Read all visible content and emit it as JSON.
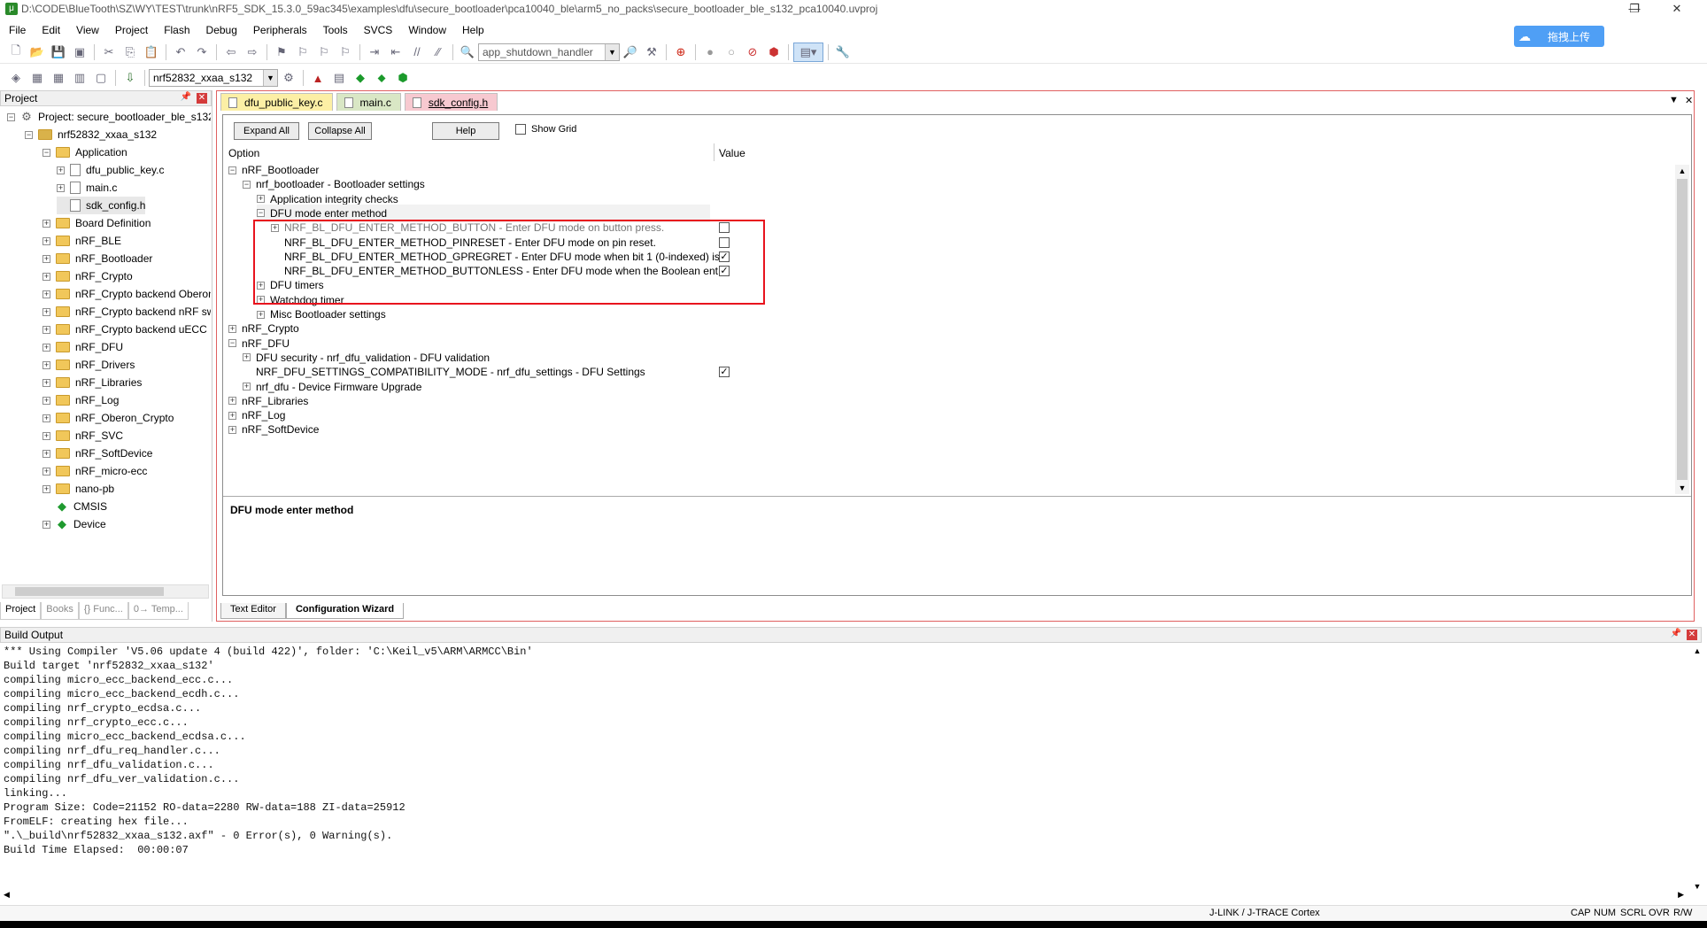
{
  "window": {
    "title": "D:\\CODE\\BlueTooth\\SZ\\WY\\TEST\\trunk\\nRF5_SDK_15.3.0_59ac345\\examples\\dfu\\secure_bootloader\\pca10040_ble\\arm5_no_packs\\secure_bootloader_ble_s132_pca10040.uvproj",
    "minimize": "—",
    "restore": "❐",
    "close": "✕"
  },
  "menu": [
    "File",
    "Edit",
    "View",
    "Project",
    "Flash",
    "Debug",
    "Peripherals",
    "Tools",
    "SVCS",
    "Window",
    "Help"
  ],
  "toolbar": {
    "function_combo": "app_shutdown_handler",
    "target_combo": "nrf52832_xxaa_s132"
  },
  "upload_button": "拖拽上传",
  "project_panel": {
    "title": "Project",
    "tree": [
      {
        "label": "Project: secure_bootloader_ble_s132_",
        "indent": 0,
        "expander": "−",
        "icon": "project"
      },
      {
        "label": "nrf52832_xxaa_s132",
        "indent": 1,
        "expander": "−",
        "icon": "target"
      },
      {
        "label": "Application",
        "indent": 2,
        "expander": "−",
        "icon": "folder"
      },
      {
        "label": "dfu_public_key.c",
        "indent": 3,
        "expander": "+",
        "icon": "file"
      },
      {
        "label": "main.c",
        "indent": 3,
        "expander": "+",
        "icon": "file"
      },
      {
        "label": "sdk_config.h",
        "indent": 3,
        "expander": "",
        "icon": "file"
      },
      {
        "label": "Board Definition",
        "indent": 2,
        "expander": "+",
        "icon": "folder"
      },
      {
        "label": "nRF_BLE",
        "indent": 2,
        "expander": "+",
        "icon": "folder"
      },
      {
        "label": "nRF_Bootloader",
        "indent": 2,
        "expander": "+",
        "icon": "folder"
      },
      {
        "label": "nRF_Crypto",
        "indent": 2,
        "expander": "+",
        "icon": "folder"
      },
      {
        "label": "nRF_Crypto backend Oberon",
        "indent": 2,
        "expander": "+",
        "icon": "folder"
      },
      {
        "label": "nRF_Crypto backend nRF sw",
        "indent": 2,
        "expander": "+",
        "icon": "folder"
      },
      {
        "label": "nRF_Crypto backend uECC",
        "indent": 2,
        "expander": "+",
        "icon": "folder"
      },
      {
        "label": "nRF_DFU",
        "indent": 2,
        "expander": "+",
        "icon": "folder"
      },
      {
        "label": "nRF_Drivers",
        "indent": 2,
        "expander": "+",
        "icon": "folder"
      },
      {
        "label": "nRF_Libraries",
        "indent": 2,
        "expander": "+",
        "icon": "folder"
      },
      {
        "label": "nRF_Log",
        "indent": 2,
        "expander": "+",
        "icon": "folder"
      },
      {
        "label": "nRF_Oberon_Crypto",
        "indent": 2,
        "expander": "+",
        "icon": "folder"
      },
      {
        "label": "nRF_SVC",
        "indent": 2,
        "expander": "+",
        "icon": "folder"
      },
      {
        "label": "nRF_SoftDevice",
        "indent": 2,
        "expander": "+",
        "icon": "folder"
      },
      {
        "label": "nRF_micro-ecc",
        "indent": 2,
        "expander": "+",
        "icon": "folder"
      },
      {
        "label": "nano-pb",
        "indent": 2,
        "expander": "+",
        "icon": "folder"
      },
      {
        "label": "CMSIS",
        "indent": 2,
        "expander": "",
        "icon": "gem"
      },
      {
        "label": "Device",
        "indent": 2,
        "expander": "+",
        "icon": "gem"
      }
    ],
    "bottom_tabs": [
      "Project",
      "Books",
      "{} Func...",
      "0→ Temp..."
    ]
  },
  "file_tabs": [
    {
      "label": "dfu_public_key.c",
      "style": "y"
    },
    {
      "label": "main.c",
      "style": "g"
    },
    {
      "label": "sdk_config.h",
      "style": "active"
    }
  ],
  "wizard": {
    "expand_all": "Expand All",
    "collapse_all": "Collapse All",
    "help": "Help",
    "show_grid": "Show Grid",
    "col_option": "Option",
    "col_value": "Value",
    "rows": [
      {
        "label": "nRF_Bootloader",
        "indent": 0,
        "expander": "−",
        "value": null,
        "dim": false
      },
      {
        "label": "nrf_bootloader - Bootloader settings",
        "indent": 1,
        "expander": "−",
        "value": null,
        "dim": false
      },
      {
        "label": "Application integrity checks",
        "indent": 2,
        "expander": "+",
        "value": null,
        "dim": false
      },
      {
        "label": "DFU mode enter method",
        "indent": 2,
        "expander": "−",
        "value": null,
        "dim": false,
        "highlight": true
      },
      {
        "label": "NRF_BL_DFU_ENTER_METHOD_BUTTON - Enter DFU mode on button press.",
        "indent": 3,
        "expander": "+",
        "value": false,
        "dim": true
      },
      {
        "label": "NRF_BL_DFU_ENTER_METHOD_PINRESET  - Enter DFU mode on pin reset.",
        "indent": 3,
        "expander": "",
        "value": false,
        "dim": false
      },
      {
        "label": "NRF_BL_DFU_ENTER_METHOD_GPREGRET  - Enter DFU mode when bit 1 (0-indexed) is...",
        "indent": 3,
        "expander": "",
        "value": true,
        "dim": false
      },
      {
        "label": "NRF_BL_DFU_ENTER_METHOD_BUTTONLESS  - Enter DFU mode when the Boolean ent...",
        "indent": 3,
        "expander": "",
        "value": true,
        "dim": false
      },
      {
        "label": "DFU timers",
        "indent": 2,
        "expander": "+",
        "value": null,
        "dim": false
      },
      {
        "label": "Watchdog timer",
        "indent": 2,
        "expander": "+",
        "value": null,
        "dim": false
      },
      {
        "label": "Misc Bootloader settings",
        "indent": 2,
        "expander": "+",
        "value": null,
        "dim": false
      },
      {
        "label": "nRF_Crypto",
        "indent": 0,
        "expander": "+",
        "value": null,
        "dim": false
      },
      {
        "label": "nRF_DFU",
        "indent": 0,
        "expander": "−",
        "value": null,
        "dim": false
      },
      {
        "label": "DFU security - nrf_dfu_validation - DFU validation",
        "indent": 1,
        "expander": "+",
        "value": null,
        "dim": false
      },
      {
        "label": "NRF_DFU_SETTINGS_COMPATIBILITY_MODE  - nrf_dfu_settings - DFU Settings",
        "indent": 1,
        "expander": "",
        "value": true,
        "dim": false
      },
      {
        "label": "nrf_dfu - Device Firmware Upgrade",
        "indent": 1,
        "expander": "+",
        "value": null,
        "dim": false
      },
      {
        "label": "nRF_Libraries",
        "indent": 0,
        "expander": "+",
        "value": null,
        "dim": false
      },
      {
        "label": "nRF_Log",
        "indent": 0,
        "expander": "+",
        "value": null,
        "dim": false
      },
      {
        "label": "nRF_SoftDevice",
        "indent": 0,
        "expander": "+",
        "value": null,
        "dim": false
      }
    ],
    "description": "DFU mode enter method"
  },
  "view_tabs": {
    "text_editor": "Text Editor",
    "config_wizard": "Configuration Wizard"
  },
  "build_output": {
    "title": "Build Output",
    "lines": [
      "*** Using Compiler 'V5.06 update 4 (build 422)', folder: 'C:\\Keil_v5\\ARM\\ARMCC\\Bin'",
      "Build target 'nrf52832_xxaa_s132'",
      "compiling micro_ecc_backend_ecc.c...",
      "compiling micro_ecc_backend_ecdh.c...",
      "compiling nrf_crypto_ecdsa.c...",
      "compiling nrf_crypto_ecc.c...",
      "compiling micro_ecc_backend_ecdsa.c...",
      "compiling nrf_dfu_req_handler.c...",
      "compiling nrf_dfu_validation.c...",
      "compiling nrf_dfu_ver_validation.c...",
      "linking...",
      "Program Size: Code=21152 RO-data=2280 RW-data=188 ZI-data=25912",
      "FromELF: creating hex file...",
      "\".\\_build\\nrf52832_xxaa_s132.axf\" - 0 Error(s), 0 Warning(s).",
      "Build Time Elapsed:  00:00:07"
    ]
  },
  "status": {
    "debugger": "J-LINK / J-TRACE Cortex",
    "cap": "CAP",
    "num": "NUM",
    "scrl": "SCRL",
    "ovr": "OVR",
    "rw": "R/W"
  },
  "colors": {
    "highlight_box": "#e8131d",
    "active_tab": "#f7c9d0"
  }
}
